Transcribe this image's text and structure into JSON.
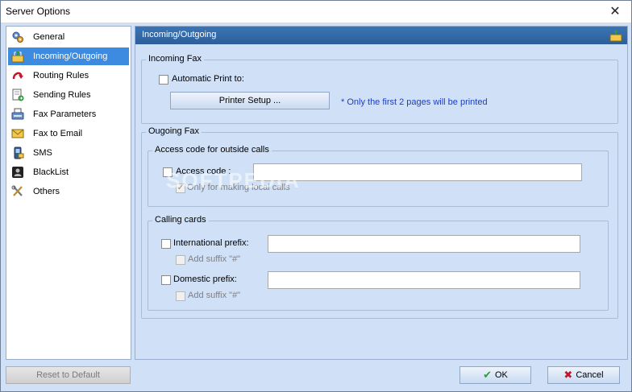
{
  "window": {
    "title": "Server Options",
    "close_glyph": "✕"
  },
  "sidebar": {
    "items": [
      {
        "label": "General",
        "icon": "gear-icon"
      },
      {
        "label": "Incoming/Outgoing",
        "icon": "inbox-arrow-icon"
      },
      {
        "label": "Routing Rules",
        "icon": "routing-arrow-icon"
      },
      {
        "label": "Sending Rules",
        "icon": "document-send-icon"
      },
      {
        "label": "Fax Parameters",
        "icon": "fax-machine-icon"
      },
      {
        "label": "Fax to Email",
        "icon": "envelope-icon"
      },
      {
        "label": "SMS",
        "icon": "phone-icon"
      },
      {
        "label": "BlackList",
        "icon": "blacklist-icon"
      },
      {
        "label": "Others",
        "icon": "tools-icon"
      }
    ],
    "selected_index": 1
  },
  "panel": {
    "header": "Incoming/Outgoing",
    "incoming": {
      "legend": "Incoming Fax",
      "auto_print_label": "Automatic Print to:",
      "auto_print_checked": false,
      "printer_setup_label": "Printer Setup ...",
      "note": "* Only the first 2 pages will be printed"
    },
    "outgoing": {
      "legend": "Ougoing Fax",
      "access": {
        "legend": "Access code for outside calls",
        "code_label": "Access code :",
        "code_value": "",
        "local_label": "Only for making local calls",
        "local_checked": true
      },
      "calling": {
        "legend": "Calling cards",
        "intl_label": "International prefix:",
        "intl_value": "",
        "intl_suffix_label": "Add suffix \"#\"",
        "domestic_label": "Domestic prefix:",
        "domestic_value": "",
        "domestic_suffix_label": "Add suffix \"#\""
      }
    }
  },
  "footer": {
    "reset_label": "Reset to Default",
    "ok_label": "OK",
    "cancel_label": "Cancel"
  },
  "watermark": "SOFTPEDIA",
  "colors": {
    "accent": "#3d8be0",
    "header": "#2f64a3",
    "note": "#1c3fbf"
  }
}
